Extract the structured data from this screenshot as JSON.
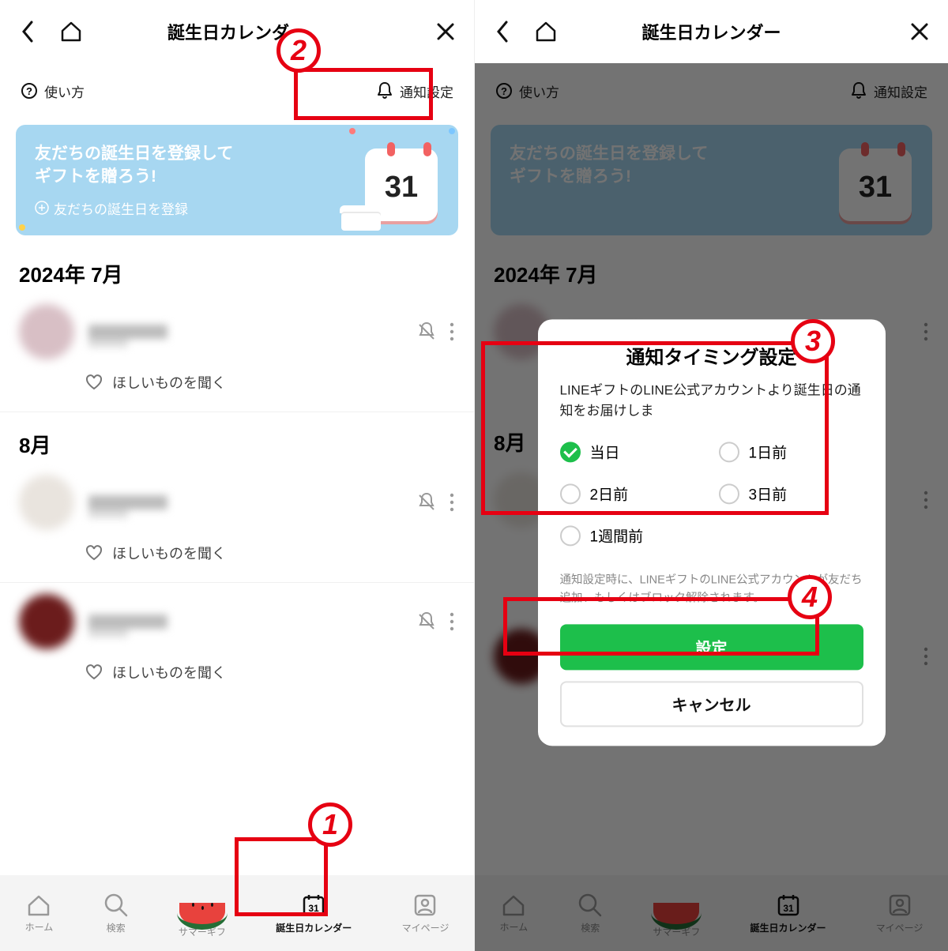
{
  "header": {
    "title": "誕生日カレンダー"
  },
  "subbar": {
    "help": "使い方",
    "notify": "通知設定"
  },
  "promo": {
    "line1": "友だちの誕生日を登録して",
    "line2": "ギフトを贈ろう!",
    "link": "友だちの誕生日を登録",
    "cal_number": "31"
  },
  "months": {
    "m1": "2024年 7月",
    "m2": "8月"
  },
  "wishlist": "ほしいものを聞く",
  "nav": {
    "home": "ホーム",
    "search": "検索",
    "summer": "サマーギフ",
    "calendar": "誕生日カレンダー",
    "mypage": "マイページ",
    "cal_icon_num": "31"
  },
  "dialog": {
    "title": "通知タイミング設定",
    "subtitle": "LINEギフトのLINE公式アカウントより誕生日の通知をお届けしま",
    "options": {
      "o1": "当日",
      "o2": "1日前",
      "o3": "2日前",
      "o4": "3日前",
      "o5": "1週間前"
    },
    "note": "通知設定時に、LINEギフトのLINE公式アカウントが友だち追加、もしくはブロック解除されます。",
    "primary": "設定",
    "secondary": "キャンセル"
  },
  "annotations": {
    "n1": "1",
    "n2": "2",
    "n3": "3",
    "n4": "4"
  }
}
